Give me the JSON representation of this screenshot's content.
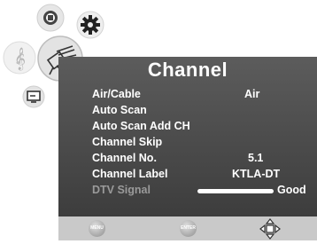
{
  "menu": {
    "title": "Channel",
    "items": [
      {
        "label": "Air/Cable",
        "value": "Air"
      },
      {
        "label": "Auto  Scan",
        "value": ""
      },
      {
        "label": "Auto  Scan Add CH",
        "value": ""
      },
      {
        "label": "Channel Skip",
        "value": ""
      },
      {
        "label": "Channel  No.",
        "value": "5.1"
      },
      {
        "label": "Channel  Label",
        "value": "KTLA-DT"
      }
    ],
    "signal": {
      "label": "DTV Signal",
      "value": "Good",
      "level": 1.0
    }
  },
  "footer": {
    "menu_label": "MENU",
    "enter_label": "ENTER"
  },
  "icons": {
    "sidebar": [
      "picture-icon",
      "settings-icon",
      "audio-icon",
      "channel-antenna-icon",
      "tv-icon"
    ],
    "footer_nav": "navigation-arrows-icon"
  },
  "colors": {
    "panel": "#4e4e4e",
    "footer": "#c9c9c9",
    "text": "#ffffff",
    "dim_text": "#9a9a9a"
  }
}
